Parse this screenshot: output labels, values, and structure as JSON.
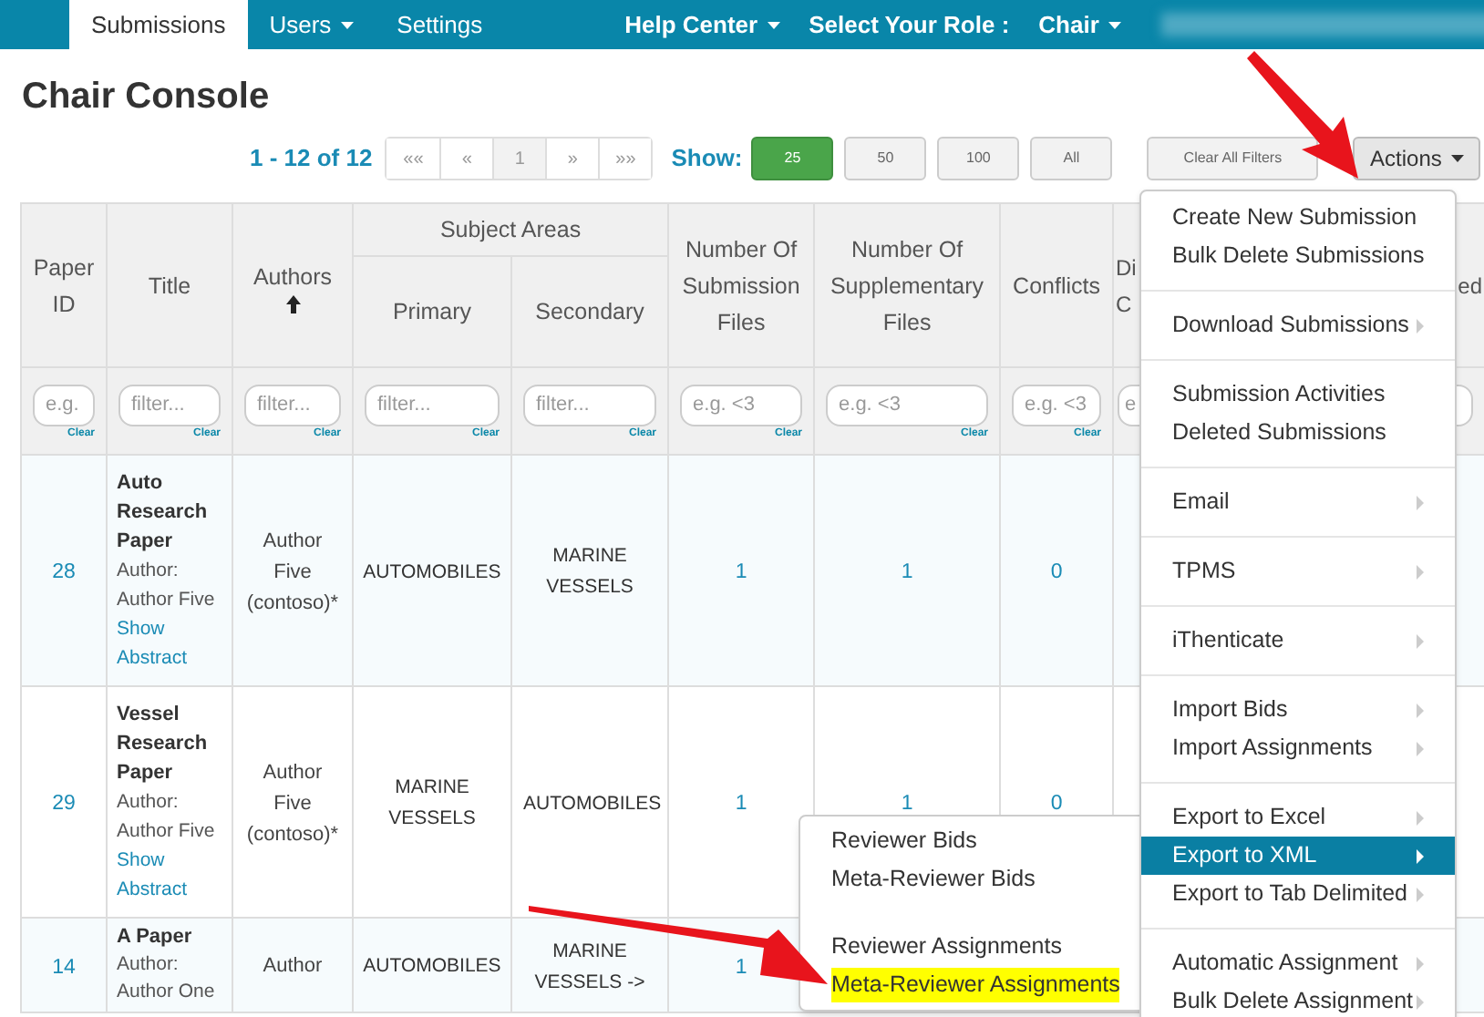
{
  "nav": {
    "tabs": [
      {
        "label": "Submissions",
        "selected": true,
        "dropdown": false
      },
      {
        "label": "Users",
        "selected": false,
        "dropdown": true
      },
      {
        "label": "Settings",
        "selected": false,
        "dropdown": false
      }
    ],
    "right": [
      {
        "label": "Help Center",
        "dropdown": true
      },
      {
        "label": "Select Your Role :",
        "dropdown": false
      },
      {
        "label": "Chair",
        "dropdown": true
      }
    ]
  },
  "page_title": "Chair Console",
  "toolbar": {
    "range": "1 - 12 of 12",
    "pages": [
      {
        "label": "««",
        "selected": false
      },
      {
        "label": "«",
        "selected": false
      },
      {
        "label": "1",
        "selected": true
      },
      {
        "label": "»",
        "selected": false
      },
      {
        "label": "»»",
        "selected": false
      }
    ],
    "show_label": "Show:",
    "page_sizes": [
      {
        "label": "25",
        "selected": true
      },
      {
        "label": "50",
        "selected": false
      },
      {
        "label": "100",
        "selected": false
      },
      {
        "label": "All",
        "selected": false
      }
    ],
    "clear_filters": "Clear All Filters",
    "actions": {
      "label": "Actions",
      "expanded": true
    }
  },
  "table": {
    "columns": [
      {
        "label": "Paper ID"
      },
      {
        "label": "Title"
      },
      {
        "label": "Authors",
        "sorted_ascending": true
      },
      {
        "label": "Subject Areas",
        "children": [
          {
            "label": "Primary"
          },
          {
            "label": "Secondary"
          }
        ]
      },
      {
        "label": "Number Of Submission Files"
      },
      {
        "label": "Number Of Supplementary Files"
      },
      {
        "label": "Conflicts"
      },
      {
        "label": "Di C"
      },
      {
        "label": "ed"
      }
    ],
    "filters": [
      {
        "placeholder": "e.g.",
        "clear": "Clear"
      },
      {
        "placeholder": "filter...",
        "clear": "Clear"
      },
      {
        "placeholder": "filter...",
        "clear": "Clear"
      },
      {
        "placeholder": "filter...",
        "clear": "Clear"
      },
      {
        "placeholder": "filter...",
        "clear": "Clear"
      },
      {
        "placeholder": "e.g. <3",
        "clear": "Clear"
      },
      {
        "placeholder": "e.g. <3",
        "clear": "Clear"
      },
      {
        "placeholder": "e.g. <3",
        "clear": "Clear"
      },
      {
        "placeholder": "e"
      }
    ],
    "rows": [
      {
        "paper_id": "28",
        "title": "Auto Research Paper",
        "author_line": "Author: Author Five",
        "abstract_link": "Show Abstract",
        "authors": "Author Five (contoso)*",
        "primary": "AUTOMOBILES",
        "secondary": "MARINE VESSELS",
        "submission_files": "1",
        "supplementary_files": "1",
        "conflicts": "0"
      },
      {
        "paper_id": "29",
        "title": "Vessel Research Paper",
        "author_line": "Author: Author Five",
        "abstract_link": "Show Abstract",
        "authors": "Author Five (contoso)*",
        "primary": "MARINE VESSELS",
        "secondary": "AUTOMOBILES",
        "submission_files": "1",
        "supplementary_files": "1",
        "conflicts": "0"
      },
      {
        "paper_id": "14",
        "title": "A Paper",
        "author_line": "Author: Author One",
        "authors": "Author",
        "primary": "AUTOMOBILES",
        "secondary": "MARINE VESSELS ->",
        "submission_files": "1"
      }
    ]
  },
  "actions_menu": {
    "groups": [
      [
        {
          "label": "Create New Submission",
          "submenu": false,
          "selected": false
        },
        {
          "label": "Bulk Delete Submissions",
          "submenu": false,
          "selected": false
        }
      ],
      [
        {
          "label": "Download Submissions",
          "submenu": true,
          "selected": false
        }
      ],
      [
        {
          "label": "Submission Activities",
          "submenu": false,
          "selected": false
        },
        {
          "label": "Deleted Submissions",
          "submenu": false,
          "selected": false
        }
      ],
      [
        {
          "label": "Email",
          "submenu": true,
          "selected": false
        }
      ],
      [
        {
          "label": "TPMS",
          "submenu": true,
          "selected": false
        }
      ],
      [
        {
          "label": "iThenticate",
          "submenu": true,
          "selected": false
        }
      ],
      [
        {
          "label": "Import Bids",
          "submenu": true,
          "selected": false
        },
        {
          "label": "Import Assignments",
          "submenu": true,
          "selected": false
        }
      ],
      [
        {
          "label": "Export to Excel",
          "submenu": true,
          "selected": false
        },
        {
          "label": "Export to XML",
          "submenu": true,
          "selected": true
        },
        {
          "label": "Export to Tab Delimited",
          "submenu": true,
          "selected": false
        }
      ],
      [
        {
          "label": "Automatic Assignment",
          "submenu": true,
          "selected": false
        },
        {
          "label": "Bulk Delete Assignment",
          "submenu": true,
          "selected": false
        }
      ]
    ]
  },
  "export_submenu": {
    "groups": [
      [
        {
          "label": "Reviewer Bids",
          "highlighted": false
        },
        {
          "label": "Meta-Reviewer Bids",
          "highlighted": false
        }
      ],
      [
        {
          "label": "Reviewer Assignments",
          "highlighted": false
        },
        {
          "label": "Meta-Reviewer Assignments",
          "highlighted": true
        }
      ]
    ]
  }
}
